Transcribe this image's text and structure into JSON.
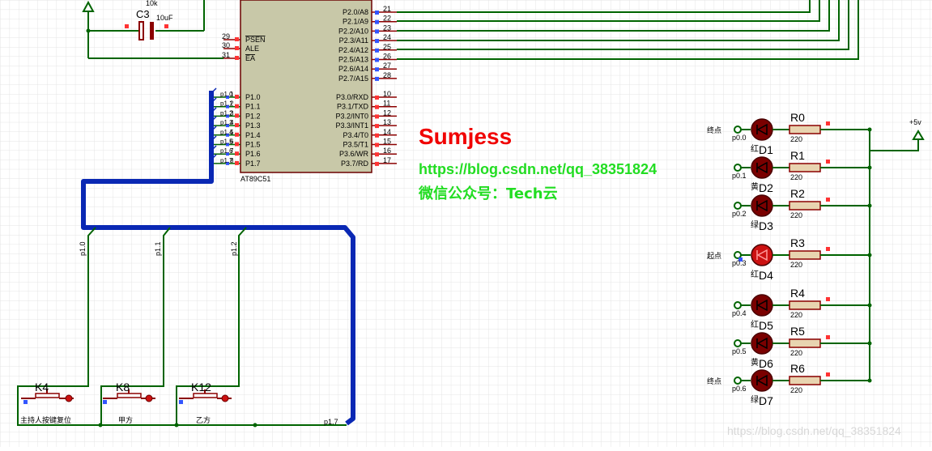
{
  "mcu": {
    "name": "AT89C51",
    "left_pins": [
      {
        "num": "29",
        "label": "PSEN"
      },
      {
        "num": "30",
        "label": "ALE"
      },
      {
        "num": "31",
        "label": "EA"
      }
    ],
    "p1_pins": [
      {
        "num": "1",
        "label": "P1.0",
        "net": "p1.0"
      },
      {
        "num": "2",
        "label": "P1.1",
        "net": "p1.1"
      },
      {
        "num": "3",
        "label": "P1.2",
        "net": "p1.2"
      },
      {
        "num": "4",
        "label": "P1.3",
        "net": "p1.3"
      },
      {
        "num": "5",
        "label": "P1.4",
        "net": "p1.4"
      },
      {
        "num": "6",
        "label": "P1.5",
        "net": "p1.5"
      },
      {
        "num": "7",
        "label": "P1.6",
        "net": "p1.6"
      },
      {
        "num": "8",
        "label": "P1.7",
        "net": "p1.7"
      }
    ],
    "p2_pins": [
      {
        "num": "21",
        "label": "P2.0/A8"
      },
      {
        "num": "22",
        "label": "P2.1/A9"
      },
      {
        "num": "23",
        "label": "P2.2/A10"
      },
      {
        "num": "24",
        "label": "P2.3/A11"
      },
      {
        "num": "25",
        "label": "P2.4/A12"
      },
      {
        "num": "26",
        "label": "P2.5/A13"
      },
      {
        "num": "27",
        "label": "P2.6/A14"
      },
      {
        "num": "28",
        "label": "P2.7/A15"
      }
    ],
    "p3_pins": [
      {
        "num": "10",
        "label": "P3.0/RXD"
      },
      {
        "num": "11",
        "label": "P3.1/TXD"
      },
      {
        "num": "12",
        "label": "P3.2/INT0"
      },
      {
        "num": "13",
        "label": "P3.3/INT1"
      },
      {
        "num": "14",
        "label": "P3.4/T0"
      },
      {
        "num": "15",
        "label": "P3.5/T1"
      },
      {
        "num": "16",
        "label": "P3.6/WR"
      },
      {
        "num": "17",
        "label": "P3.7/RD"
      }
    ]
  },
  "capacitor": {
    "ref": "C3",
    "value": "10uF",
    "resistor_value": "10k"
  },
  "bus_labels": [
    "p1.0",
    "p1.1",
    "p1.2",
    "p1.7"
  ],
  "buttons": [
    {
      "ref": "K4",
      "label": "主持人按键复位"
    },
    {
      "ref": "K8",
      "label": "甲方"
    },
    {
      "ref": "K12",
      "label": "乙方"
    }
  ],
  "leds": [
    {
      "ref": "D1",
      "color_label": "红",
      "net": "p0.0",
      "side_label": "终点",
      "resistor": "R0",
      "value": "220"
    },
    {
      "ref": "D2",
      "color_label": "黄",
      "net": "p0.1",
      "side_label": "",
      "resistor": "R1",
      "value": "220"
    },
    {
      "ref": "D3",
      "color_label": "绿",
      "net": "p0.2",
      "side_label": "",
      "resistor": "R2",
      "value": "220"
    },
    {
      "ref": "D4",
      "color_label": "红",
      "net": "p0.3",
      "side_label": "起点",
      "resistor": "R3",
      "value": "220"
    },
    {
      "ref": "D5",
      "color_label": "红",
      "net": "p0.4",
      "side_label": "",
      "resistor": "R4",
      "value": "220"
    },
    {
      "ref": "D6",
      "color_label": "黄",
      "net": "p0.5",
      "side_label": "",
      "resistor": "R5",
      "value": "220"
    },
    {
      "ref": "D7",
      "color_label": "绿",
      "net": "p0.6",
      "side_label": "终点",
      "resistor": "R6",
      "value": "220"
    }
  ],
  "power_label": "+5v",
  "watermark": {
    "title": "Sumjess",
    "url": "https://blog.csdn.net/qq_38351824",
    "wechat": "微信公众号：Tech云",
    "corner": "https://blog.csdn.net/qq_38351824"
  },
  "colors": {
    "grid": "#e4e4e4",
    "wire": "#006400",
    "bus": "#0a28b4",
    "chip_fill": "#c8c8a8",
    "component": "#8b0000",
    "led_lit": "#cc1111",
    "led_dark": "#7a0000",
    "title_red": "#f00000",
    "url_green": "#22dd22"
  }
}
